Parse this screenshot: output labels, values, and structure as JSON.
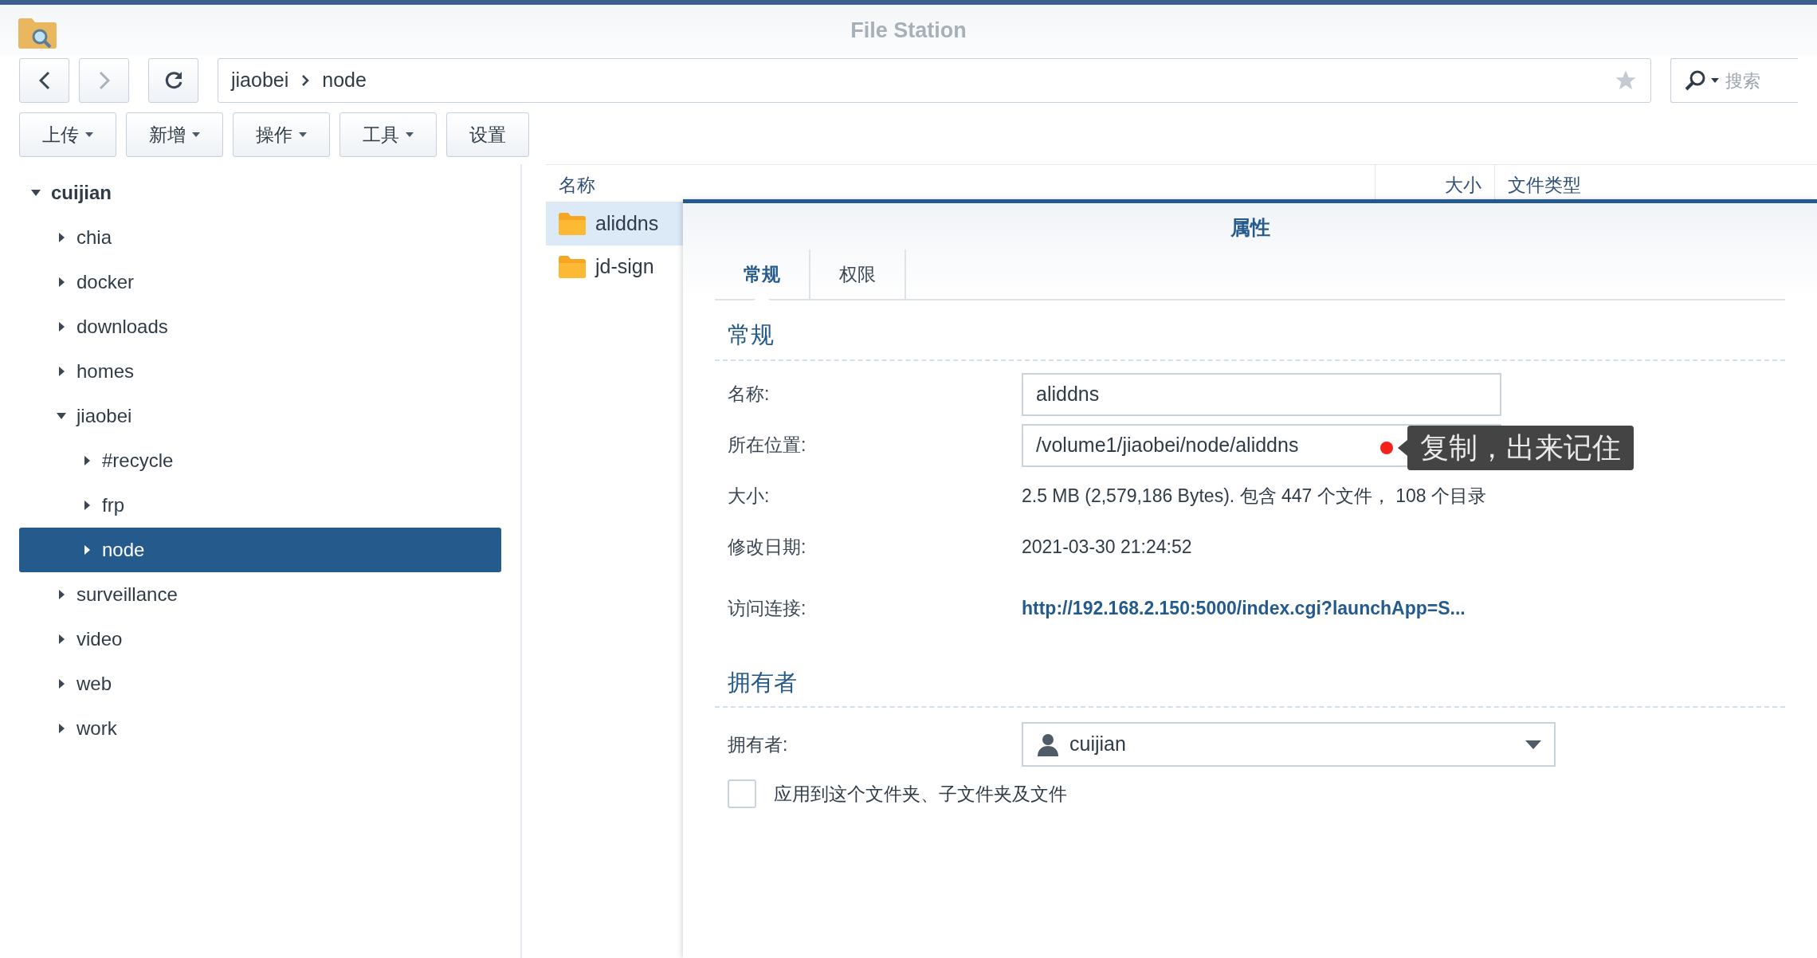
{
  "window": {
    "title": "File Station"
  },
  "nav": {
    "back_disabled": false,
    "forward_disabled": true
  },
  "path": {
    "segments": [
      "jiaobei",
      "node"
    ]
  },
  "search": {
    "placeholder": "搜索"
  },
  "toolbar": [
    {
      "label": "上传",
      "dropdown": true
    },
    {
      "label": "新增",
      "dropdown": true
    },
    {
      "label": "操作",
      "dropdown": true
    },
    {
      "label": "工具",
      "dropdown": true
    },
    {
      "label": "设置",
      "dropdown": false
    }
  ],
  "tree": [
    {
      "label": "cuijian",
      "expanded": true,
      "selected": false,
      "children": [
        {
          "label": "chia",
          "expanded": false,
          "selected": false
        },
        {
          "label": "docker",
          "expanded": false,
          "selected": false
        },
        {
          "label": "downloads",
          "expanded": false,
          "selected": false
        },
        {
          "label": "homes",
          "expanded": false,
          "selected": false
        },
        {
          "label": "jiaobei",
          "expanded": true,
          "selected": false,
          "children": [
            {
              "label": "#recycle",
              "expanded": false,
              "selected": false
            },
            {
              "label": "frp",
              "expanded": false,
              "selected": false
            },
            {
              "label": "node",
              "expanded": false,
              "selected": true
            }
          ]
        },
        {
          "label": "surveillance",
          "expanded": false,
          "selected": false
        },
        {
          "label": "video",
          "expanded": false,
          "selected": false
        },
        {
          "label": "web",
          "expanded": false,
          "selected": false
        },
        {
          "label": "work",
          "expanded": false,
          "selected": false
        }
      ]
    }
  ],
  "file_list": {
    "columns": [
      "名称",
      "大小",
      "文件类型"
    ],
    "rows": [
      {
        "name": "aliddns",
        "selected": true
      },
      {
        "name": "jd-sign",
        "selected": false
      }
    ]
  },
  "dialog": {
    "title": "属性",
    "tabs": [
      {
        "label": "常规",
        "selected": true
      },
      {
        "label": "权限",
        "selected": false
      }
    ],
    "general": {
      "heading": "常规",
      "fields": [
        {
          "kind": "input",
          "label": "名称:",
          "value": "aliddns"
        },
        {
          "kind": "input",
          "label": "所在位置:",
          "value": "/volume1/jiaobei/node/aliddns"
        },
        {
          "kind": "text",
          "label": "大小:",
          "value": "2.5 MB (2,579,186 Bytes). 包含 447 个文件， 108 个目录"
        },
        {
          "kind": "text",
          "label": "修改日期:",
          "value": "2021-03-30 21:24:52"
        },
        {
          "kind": "link",
          "label": "访问连接:",
          "value": "http://192.168.2.150:5000/index.cgi?launchApp=S..."
        }
      ]
    },
    "owner": {
      "heading": "拥有者",
      "label": "拥有者:",
      "value": "cuijian",
      "apply": {
        "label": "应用到这个文件夹、子文件夹及文件",
        "checked": false
      }
    }
  },
  "annotation": {
    "text": "复制，出来记住",
    "color": "#f5221b"
  }
}
